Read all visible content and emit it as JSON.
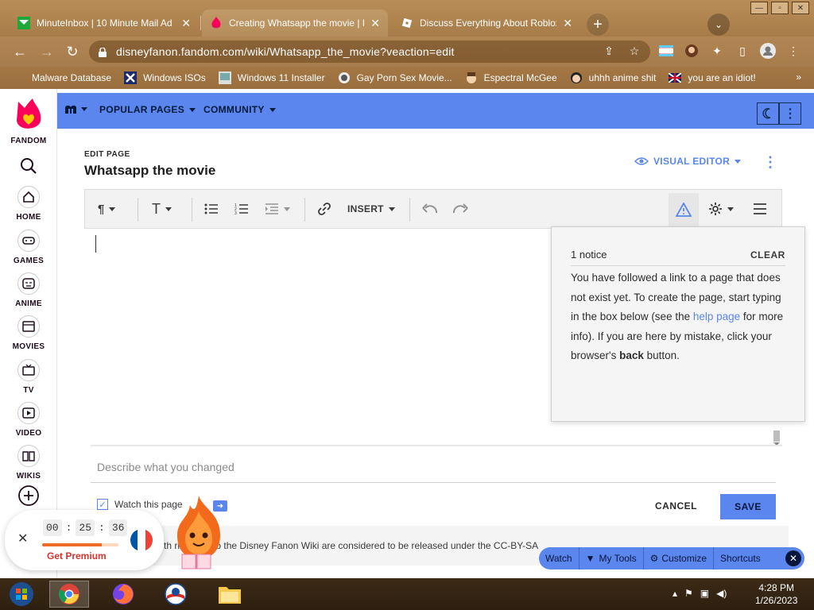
{
  "browser": {
    "tabs": [
      {
        "title": "MinuteInbox | 10 Minute Mail Ad",
        "close": "✕"
      },
      {
        "title": "Creating Whatsapp the movie | D",
        "close": "✕"
      },
      {
        "title": "Discuss Everything About Roblox",
        "close": "✕"
      }
    ],
    "url": "disneyfanon.fandom.com/wiki/Whatsapp_the_movie?veaction=edit",
    "bookmarks": [
      "Malware Database",
      "Windows ISOs",
      "Windows 11 Installer",
      "Gay Porn Sex Movie...",
      "Espectral McGee",
      "uhhh anime shit",
      "you are an idiot!"
    ],
    "bookmarks_more": "»"
  },
  "rail": {
    "brand": "FANDOM",
    "items": [
      "HOME",
      "GAMES",
      "ANIME",
      "MOVIES",
      "TV",
      "VIDEO",
      "WIKIS"
    ]
  },
  "topnav": {
    "popular_pages": "POPULAR PAGES",
    "community": "COMMUNITY"
  },
  "editor": {
    "edit_label": "EDIT PAGE",
    "page_title": "Whatsapp the movie",
    "visual_editor": "VISUAL EDITOR",
    "insert": "INSERT",
    "summary_placeholder": "Describe what you changed",
    "watch_label": "Watch this page",
    "cancel": "CANCEL",
    "save": "SAVE",
    "license_text": "th                ributions to the Disney Fanon Wiki are considered to be released under the CC-BY-SA"
  },
  "notice": {
    "count": "1 notice",
    "clear": "CLEAR",
    "text_1": "You have followed a link to a page that does not exist yet. To create the page, start typing in the box below (see the ",
    "link": "help page",
    "text_2": " for more info). If you are here by mistake, click your browser's ",
    "bold": "back",
    "text_3": " button."
  },
  "premium": {
    "hours": "00",
    "minutes": "25",
    "seconds": "36",
    "cta": "Get Premium",
    "progress": 0.78
  },
  "tools_bar": {
    "watch": "Watch",
    "my_tools": "My Tools",
    "customize": "Customize",
    "shortcuts": "Shortcuts"
  },
  "taskbar": {
    "time": "4:28 PM",
    "date": "1/26/2023"
  },
  "colors": {
    "accent": "#5a86ed",
    "fandom_pink": "#fa005a",
    "fandom_orange": "#ffc500"
  }
}
